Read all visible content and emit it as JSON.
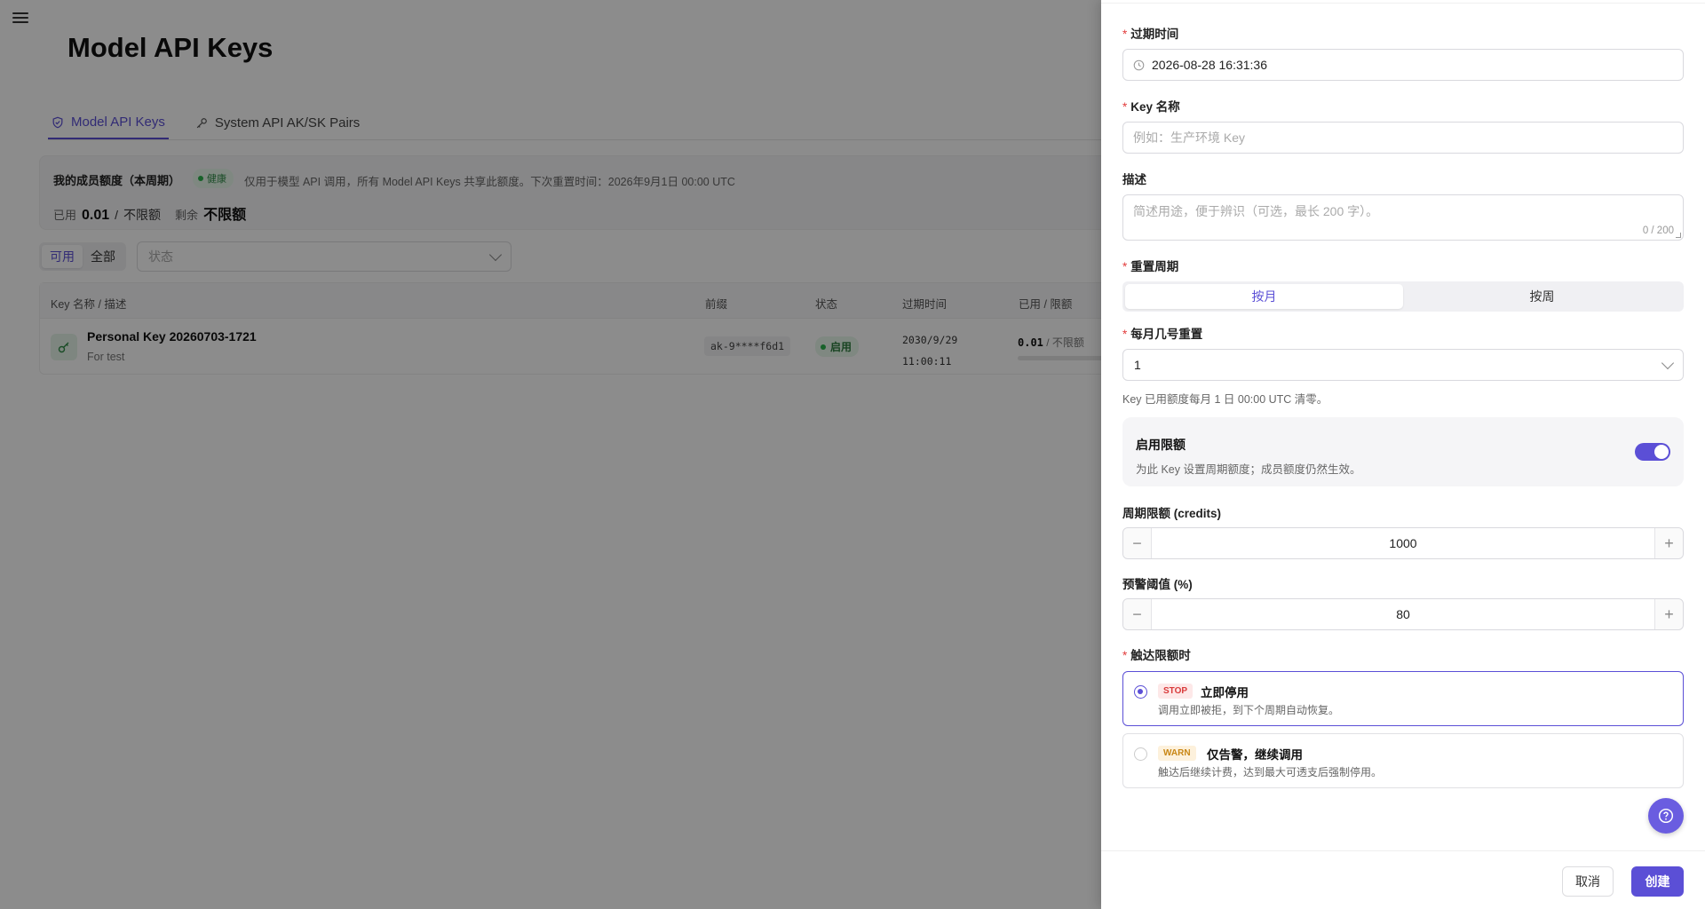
{
  "page": {
    "title": "Model API Keys",
    "tabs": [
      {
        "label": "Model API Keys",
        "icon": "shield-icon",
        "active": true
      },
      {
        "label": "System API AK/SK Pairs",
        "icon": "key-icon",
        "active": false
      }
    ],
    "quota": {
      "title": "我的成员额度（本周期）",
      "health": "健康",
      "description": "仅用于模型 API 调用，所有 Model API Keys 共享此额度。下次重置时间：2026年9月1日 00:00 UTC",
      "used_label": "已用",
      "used_value": "0.01",
      "limit_value": "不限额",
      "remaining_label": "剩余",
      "remaining_value": "不限额"
    },
    "filters": {
      "options": [
        "可用",
        "全部"
      ],
      "active": "可用",
      "status_placeholder": "状态"
    },
    "table": {
      "columns": [
        "Key 名称 / 描述",
        "前缀",
        "状态",
        "过期时间",
        "已用 / 限额"
      ],
      "rows": [
        {
          "name": "Personal Key 20260703-1721",
          "description": "For test",
          "prefix": "ak-9****f6d1",
          "status": "启用",
          "expiry_date": "2030/9/29",
          "expiry_time": "11:00:11",
          "used": "0.01",
          "limit": "/ 不限额"
        }
      ]
    }
  },
  "drawer": {
    "expiry": {
      "label": "过期时间",
      "value": "2026-08-28 16:31:36",
      "icon": "clock-icon"
    },
    "key_name": {
      "label": "Key 名称",
      "placeholder": "例如：生产环境 Key"
    },
    "description": {
      "label": "描述",
      "placeholder": "简述用途，便于辨识（可选，最长 200 字）。",
      "count": "0 / 200"
    },
    "reset_cycle": {
      "label": "重置周期",
      "options": [
        "按月",
        "按周"
      ],
      "active": "按月"
    },
    "reset_day": {
      "label": "每月几号重置",
      "value": "1",
      "help": "Key 已用额度每月 1 日 00:00 UTC 清零。"
    },
    "enable_limit": {
      "title": "启用限额",
      "description": "为此 Key 设置周期额度；成员额度仍然生效。",
      "enabled": true
    },
    "period_limit": {
      "label": "周期限额 (credits)",
      "value": "1000"
    },
    "warn_threshold": {
      "label": "预警阈值 (%)",
      "value": "80"
    },
    "on_limit": {
      "label": "触达限额时",
      "options": [
        {
          "tag": "STOP",
          "title": "立即停用",
          "description": "调用立即被拒，到下个周期自动恢复。",
          "selected": true
        },
        {
          "tag": "WARN",
          "title": "仅告警，继续调用",
          "description": "触达后继续计费，达到最大可透支后强制停用。",
          "selected": false
        }
      ]
    },
    "footer": {
      "cancel": "取消",
      "create": "创建"
    }
  },
  "colors": {
    "accent": "#5b4fd6",
    "success": "#2bb24c",
    "danger": "#d93a3a",
    "warning": "#c88614"
  }
}
